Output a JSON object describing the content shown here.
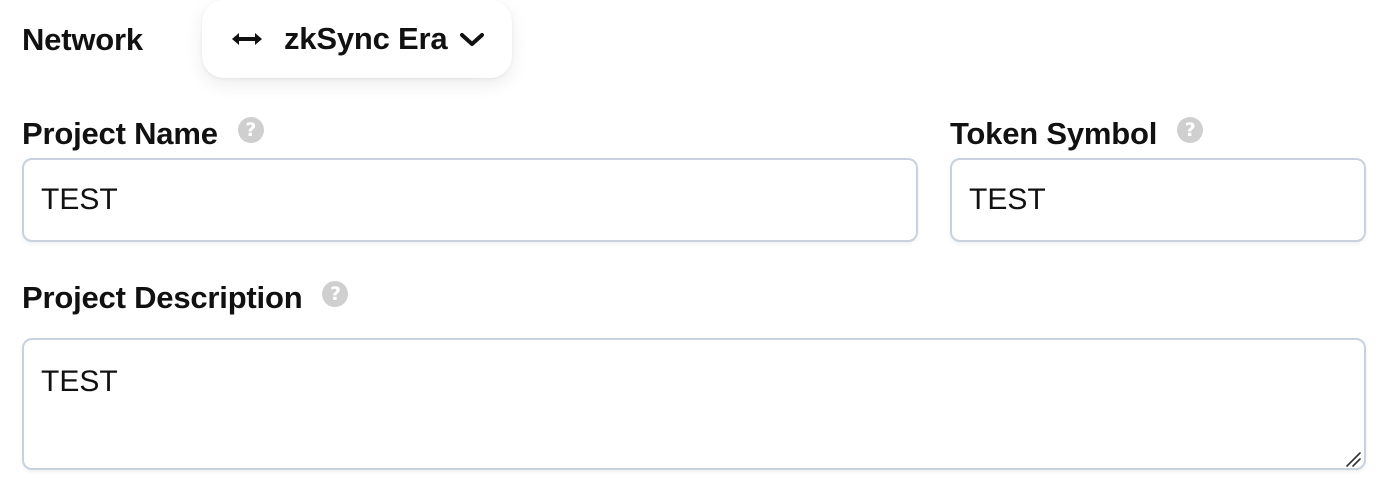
{
  "network": {
    "label": "Network",
    "selected": "zkSync Era",
    "icon": "swap-arrows-icon",
    "dropdown_icon": "chevron-down-icon"
  },
  "form": {
    "project_name": {
      "label": "Project Name",
      "value": "TEST",
      "help_icon": "?"
    },
    "token_symbol": {
      "label": "Token Symbol",
      "value": "TEST",
      "help_icon": "?"
    },
    "project_description": {
      "label": "Project Description",
      "value": "TEST",
      "help_icon": "?"
    }
  },
  "colors": {
    "input_border": "#c7d2de",
    "help_icon_bg": "#cfcfcf",
    "text": "#111111"
  }
}
